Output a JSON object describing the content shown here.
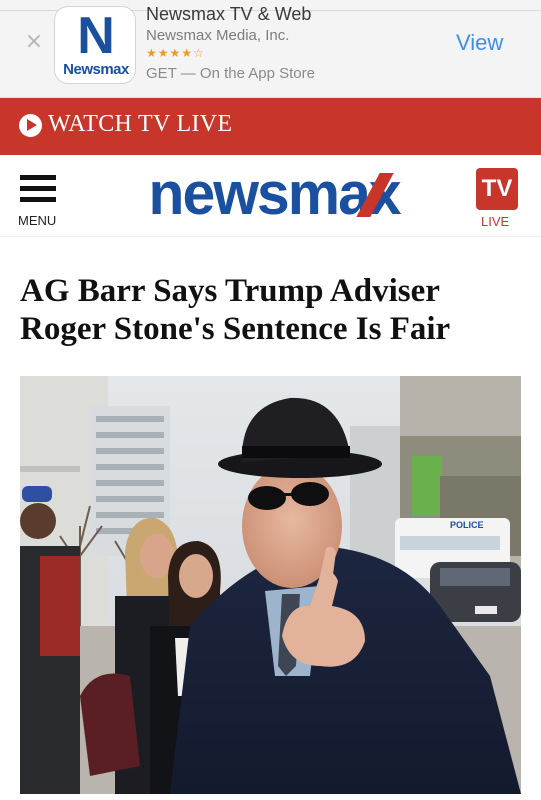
{
  "app_banner": {
    "close_glyph": "×",
    "icon_letter": "N",
    "icon_word": "Newsmax",
    "app_name": "Newsmax TV & Web",
    "publisher": "Newsmax Media, Inc.",
    "stars": "★★★★☆",
    "rating": 4.5,
    "get_text": "GET — On the App Store",
    "view_label": "View"
  },
  "watch_bar": {
    "label": "WATCH TV LIVE",
    "icon": "play-icon",
    "color": "#c8362b"
  },
  "header": {
    "menu_label": "MENU",
    "menu_icon": "hamburger-icon",
    "logo_text": "newsmax",
    "tv_label": "TV",
    "live_label": "LIVE"
  },
  "article": {
    "headline": "AG Barr Says Trump Adviser Roger Stone's Sentence Is Fair",
    "photo_sign_text": "POLICE"
  },
  "colors": {
    "brand_blue": "#1b4fa0",
    "brand_red": "#c8362b",
    "link_blue": "#3c8ff0"
  }
}
